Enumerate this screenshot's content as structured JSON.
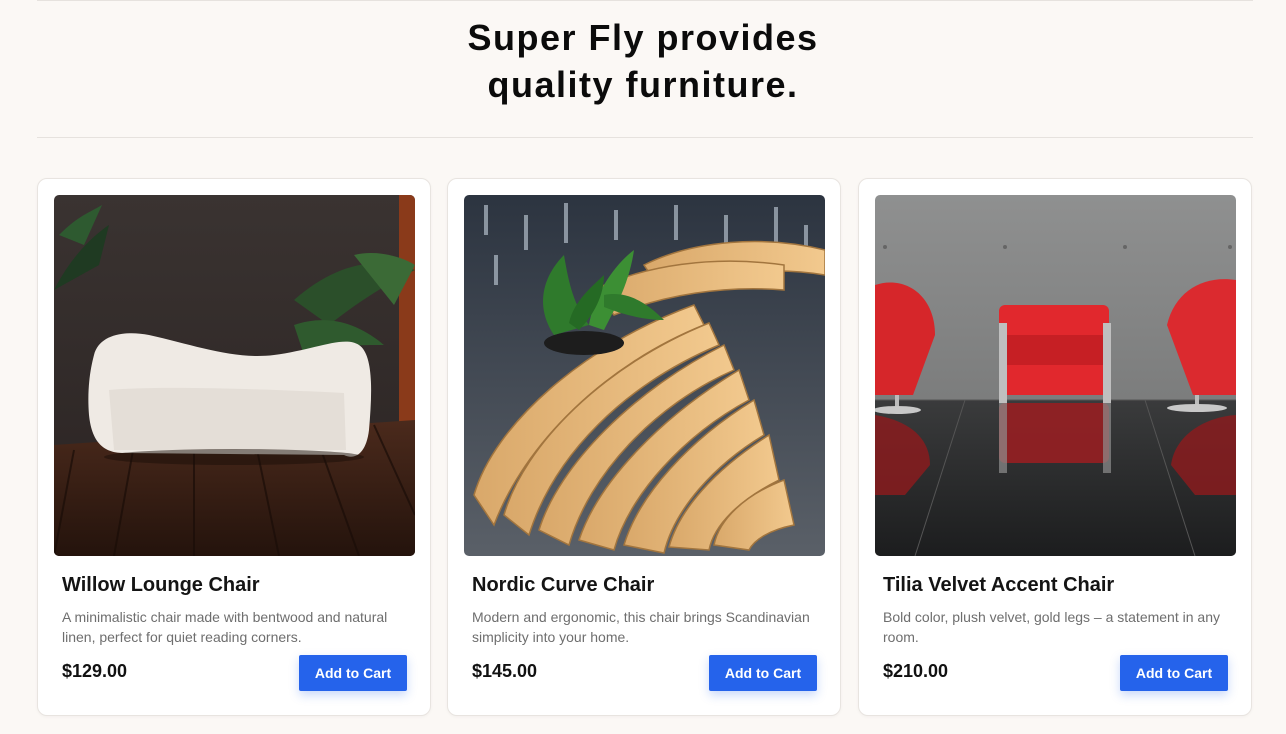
{
  "headline": {
    "line1": "Super Fly provides",
    "line2": "quality furniture."
  },
  "products": [
    {
      "name": "Willow Lounge Chair",
      "description": "A minimalistic chair made with bentwood and natural linen, perfect for quiet reading corners.",
      "price": "$129.00",
      "button_label": "Add to Cart",
      "image": "white-boucle-sofa-photo"
    },
    {
      "name": "Nordic Curve Chair",
      "description": "Modern and ergonomic, this chair brings Scandinavian simplicity into your home.",
      "price": "$145.00",
      "button_label": "Add to Cart",
      "image": "wooden-slat-bench-photo"
    },
    {
      "name": "Tilia Velvet Accent Chair",
      "description": "Bold color, plush velvet, gold legs – a statement in any room.",
      "price": "$210.00",
      "button_label": "Add to Cart",
      "image": "red-armchairs-photo"
    }
  ],
  "colors": {
    "background": "#fbf8f5",
    "accent": "#2563eb",
    "card": "#ffffff"
  }
}
